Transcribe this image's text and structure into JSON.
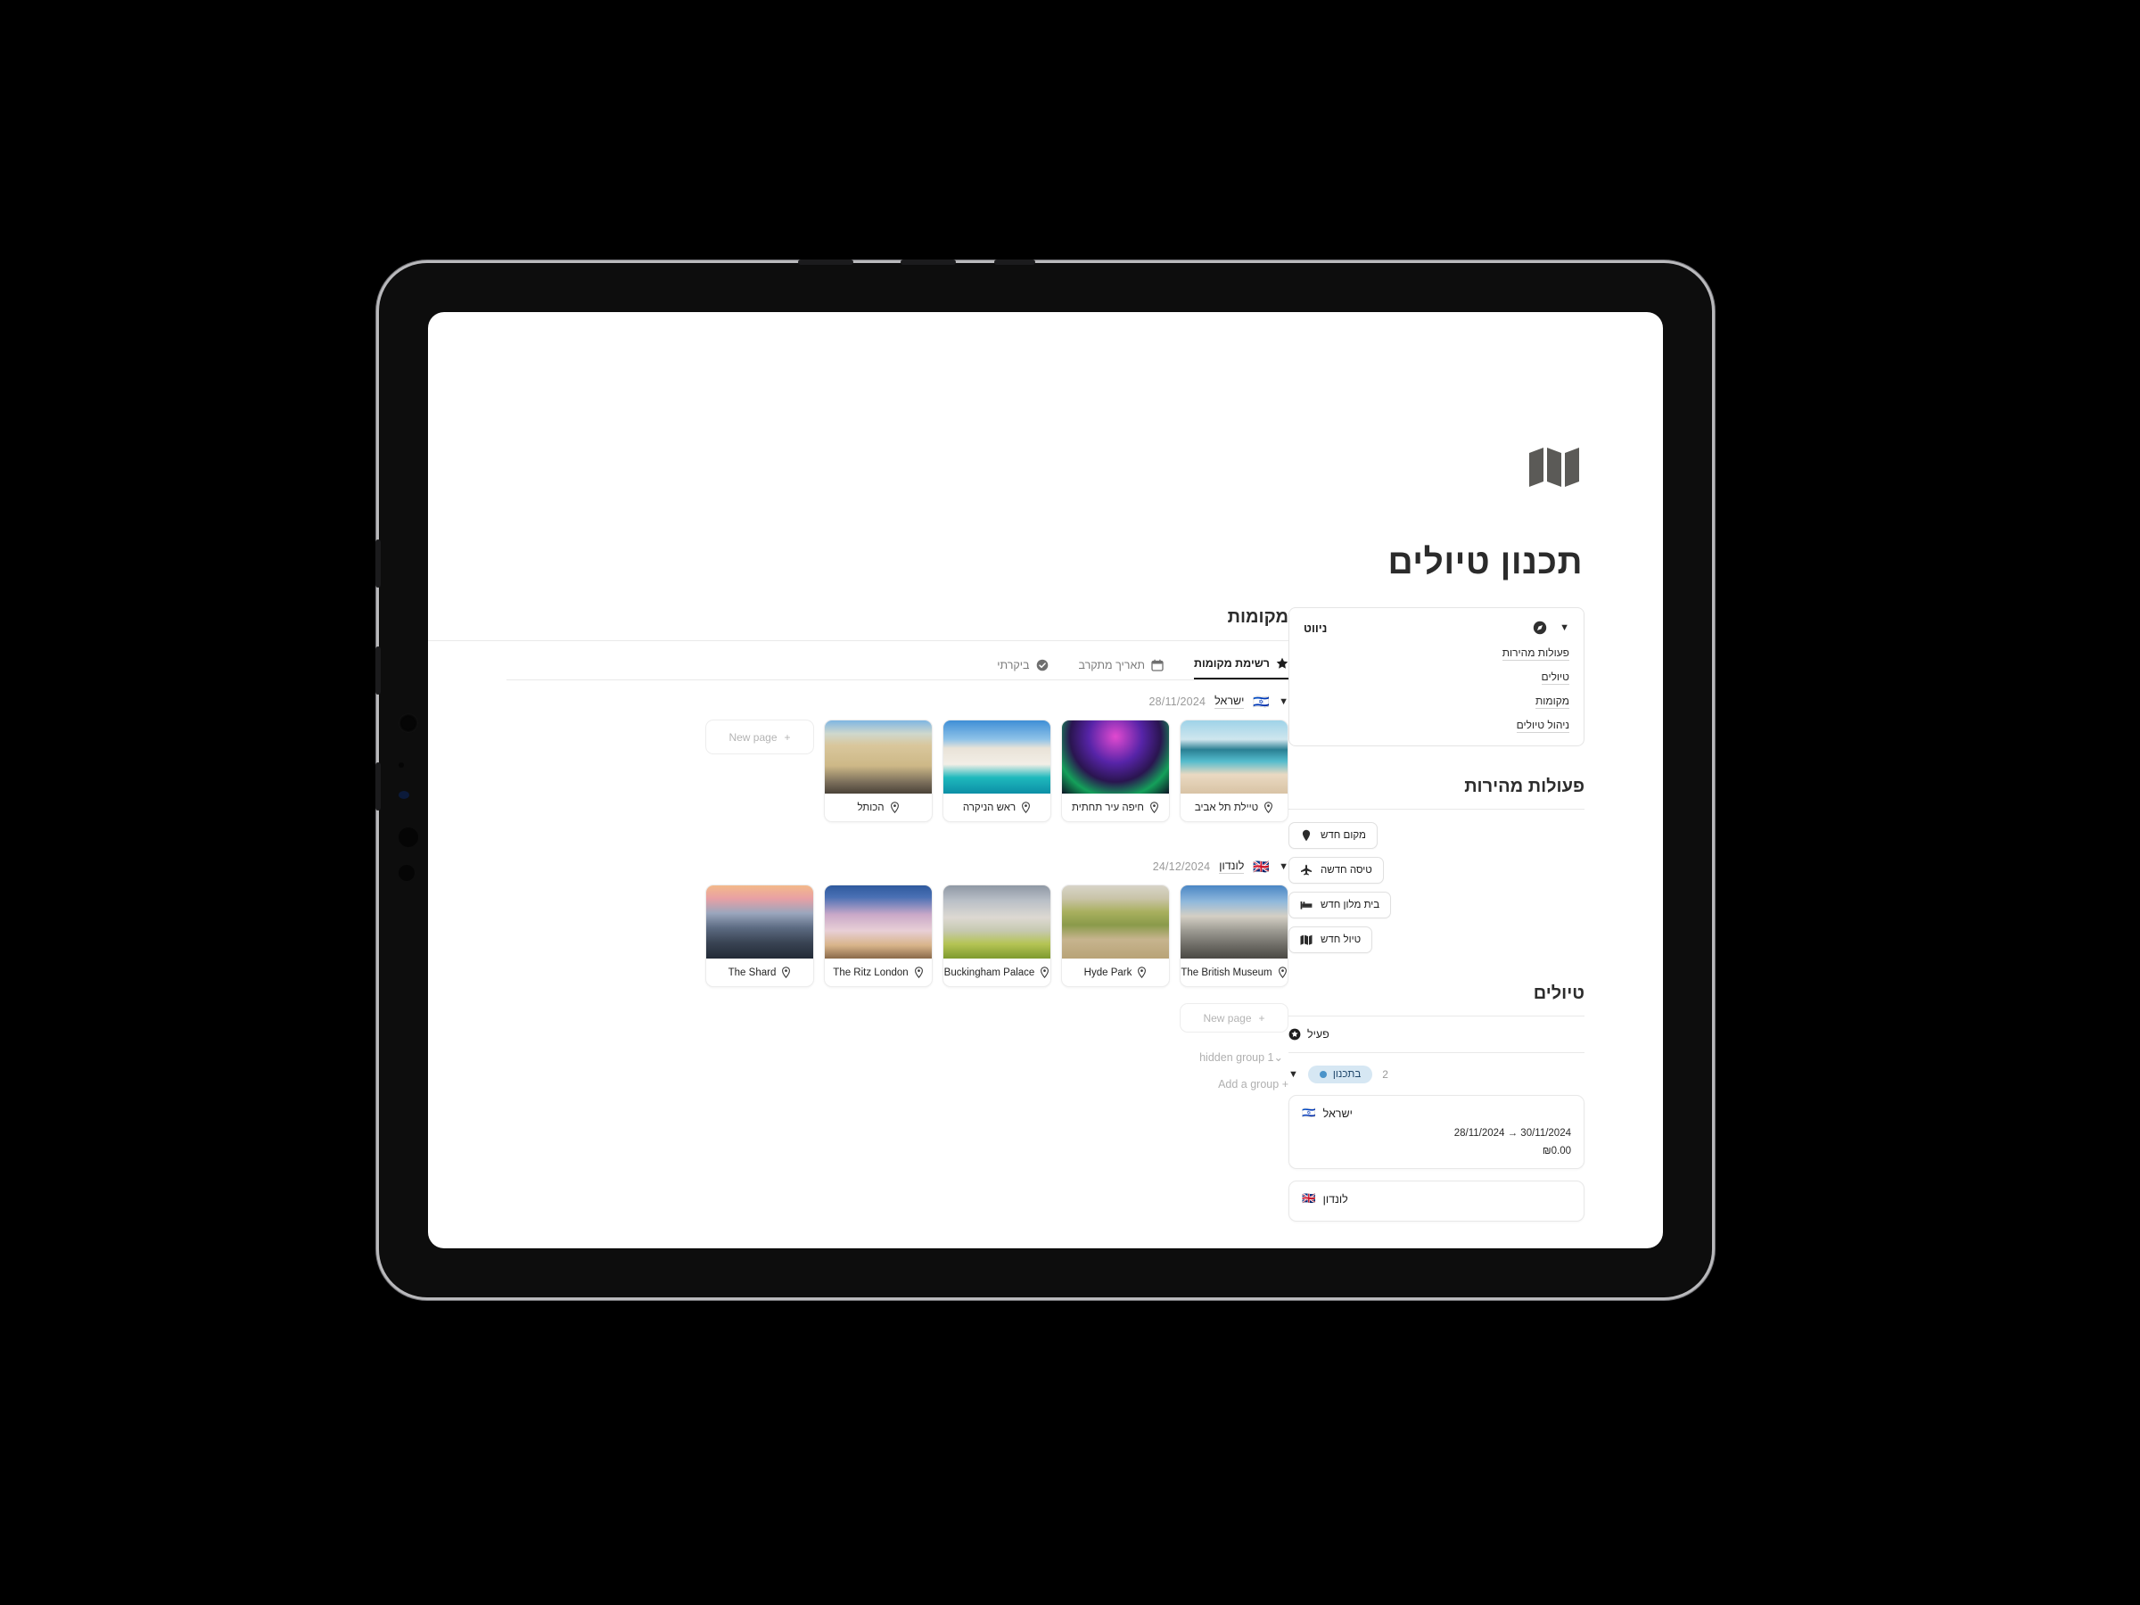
{
  "app": {
    "logo_icon": "folded-map-icon",
    "title": "תכנון טיולים"
  },
  "sidebar": {
    "nav_card": {
      "title": "ניווט",
      "caret": "▼",
      "icon": "compass-icon",
      "links": [
        {
          "label": "פעולות מהירות"
        },
        {
          "label": "טיולים"
        },
        {
          "label": "מקומות"
        },
        {
          "label": "ניהול טיולים"
        }
      ]
    },
    "quick_actions": {
      "heading": "פעולות מהירות",
      "items": [
        {
          "label": "מקום חדש",
          "icon": "map-pin-icon"
        },
        {
          "label": "טיסה חדשה",
          "icon": "airplane-icon"
        },
        {
          "label": "בית מלון חדש",
          "icon": "bed-icon"
        },
        {
          "label": "טיול חדש",
          "icon": "folded-map-icon"
        }
      ]
    },
    "trips": {
      "heading": "טיולים",
      "status": {
        "label": "פעיל",
        "icon": "star-circle-icon"
      },
      "planning": {
        "caret": "▼",
        "badge_label": "בתכנון",
        "badge_dot_color": "#4a93c9",
        "badge_bg_color": "#d6e7f3",
        "count": "2"
      },
      "cards": [
        {
          "flag": "🇮🇱",
          "name": "ישראל",
          "dates": "28/11/2024 → 30/11/2024",
          "price": "₪0.00"
        },
        {
          "flag": "🇬🇧",
          "name": "לונדון",
          "dates": "",
          "price": ""
        }
      ]
    }
  },
  "main": {
    "heading": "מקומות",
    "tabs": [
      {
        "label": "רשימת מקומות",
        "icon": "star-icon",
        "active": true
      },
      {
        "label": "תאריך מתקרב",
        "icon": "calendar-icon",
        "active": false
      },
      {
        "label": "ביקרתי",
        "icon": "check-circle-icon",
        "active": false
      }
    ],
    "groups": [
      {
        "caret": "▼",
        "flag": "🇮🇱",
        "name": "ישראל",
        "date": "28/11/2024",
        "new_page_label": "New page",
        "new_page_plus": "+",
        "new_page_position": "end",
        "cards": [
          {
            "title": "טיילת תל אביב",
            "icon": "map-pin-icon",
            "thumb": "thumb-sky1",
            "latin": false
          },
          {
            "title": "חיפה עיר תחתית",
            "icon": "map-pin-icon",
            "thumb": "thumb-neon",
            "latin": false
          },
          {
            "title": "ראש הניקרה",
            "icon": "map-pin-icon",
            "thumb": "thumb-cliff",
            "latin": false
          },
          {
            "title": "הכותל",
            "icon": "map-pin-icon",
            "thumb": "thumb-wall",
            "latin": false
          }
        ]
      },
      {
        "caret": "▼",
        "flag": "🇬🇧",
        "name": "לונדון",
        "date": "24/12/2024",
        "new_page_label": "New page",
        "new_page_plus": "+",
        "new_page_position": "below",
        "cards": [
          {
            "title": "The Shard",
            "icon": "map-pin-icon",
            "thumb": "thumb-shard",
            "latin": true
          },
          {
            "title": "The Ritz London",
            "icon": "map-pin-icon",
            "thumb": "thumb-ritz",
            "latin": true
          },
          {
            "title": "Buckingham Palace",
            "icon": "map-pin-icon",
            "thumb": "thumb-palace",
            "latin": true
          },
          {
            "title": "Hyde Park",
            "icon": "map-pin-icon",
            "thumb": "thumb-park",
            "latin": true
          },
          {
            "title": "The British Museum",
            "icon": "map-pin-icon",
            "thumb": "thumb-museum",
            "latin": true
          }
        ]
      }
    ],
    "footer": {
      "hidden_group": "hidden group 1",
      "hidden_group_caret": "⌄",
      "add_group": "Add a group",
      "add_group_plus": "+"
    }
  }
}
